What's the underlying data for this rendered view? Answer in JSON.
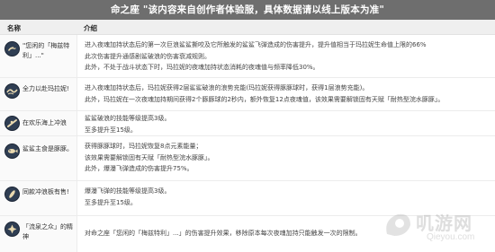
{
  "banner": {
    "text": "命之座 \"该内容来自创作者体验服，具体数据请以线上版本为准\""
  },
  "columns": {
    "name": "名称",
    "desc": "介绍"
  },
  "rows": [
    {
      "name": "\"您闲的「梅兹特利」...\"",
      "icon": "shark-icon",
      "lines": [
        "进入夜魂加持状态后的第一次巨浪鲨鲨撕咬及它所触发的鲨鲨飞弹造成的伤害提升，提升值相当于玛拉妮生命值上限的66%",
        "此次伤害提升通感剧鲨破浪的伤害衰减规则。",
        "此外，不处于战斗状态下时，玛拉妮的夜魂加持状态消耗的夜魂值与频率降低30%。"
      ]
    },
    {
      "name": "全力以赴玛拉妮!",
      "icon": "wave-icon",
      "lines": [
        "进入夜魂加持状态后，玛拉妮获得2层鲨鲨破浪的浪势充能(玛拉妮获得豚豚球时，获得1层浪势充能)。",
        "此外，玛拉妮在一次夜魂加持期间获得2个豚豚球的2秒内，额外恢复12点夜魂值，该效果需要解锁固有天赋「耐热型浣水豚豚」。"
      ]
    },
    {
      "name": "在欢乐海上冲浪",
      "icon": "surf-icon",
      "lines": [
        "鲨鲨破浪的技能等级提高3级。",
        "至多提升至15级。"
      ]
    },
    {
      "name": "鲨鲨主食是豚豚。",
      "icon": "fish-icon",
      "lines": [
        "获得豚豚球时，玛拉妮恢复8点元素能量；",
        "该效果需要解锁固有天赋「耐热型浣水豚豚」。",
        "此外，爆瀑飞弹造成的伤害提升75%。"
      ]
    },
    {
      "name": "同款冲浪板有售!",
      "icon": "board-icon",
      "lines": [
        "爆瀑飞弹的技能等级提高3级。",
        "至多提升至15级。"
      ]
    },
    {
      "name": "「流泉之众」的精神",
      "icon": "spirit-icon",
      "lines": [
        "对命之座「您闲的「梅兹特利」...」的伤害提升效果，移除原本每次夜魂加持只能触发一次的限制。"
      ]
    }
  ],
  "watermark": {
    "cn": "叽游网",
    "en": "Qieyou.com"
  }
}
